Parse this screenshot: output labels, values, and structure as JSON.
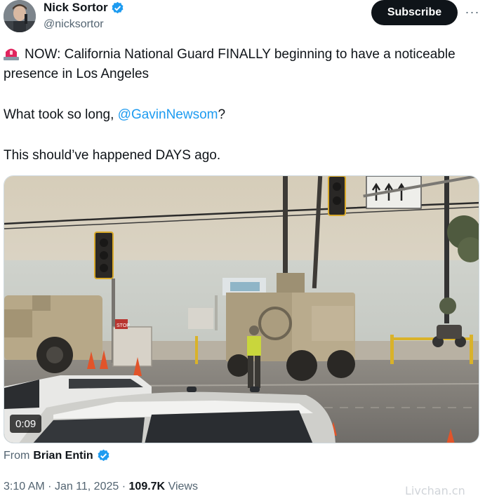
{
  "author": {
    "name": "Nick Sortor",
    "handle": "@nicksortor",
    "verified": true,
    "avatar_icon": "profile-photo"
  },
  "actions": {
    "subscribe_label": "Subscribe",
    "more_label": "···"
  },
  "tweet": {
    "line1_emoji": "rotating-light-icon",
    "line1": "NOW: California National Guard FINALLY beginning to have a noticeable presence in Los Angeles",
    "line2_prefix": "What took so long, ",
    "line2_mention": "@GavinNewsom",
    "line2_suffix": "?",
    "line3": "This should’ve happened DAYS ago."
  },
  "media": {
    "type": "video",
    "duration": "0:09",
    "sign_text": "STOP"
  },
  "attribution": {
    "prefix": "From",
    "name": "Brian Entin",
    "verified": true
  },
  "meta": {
    "time": "3:10 AM",
    "separator": "·",
    "date": "Jan 11, 2025",
    "views_count": "109.7K",
    "views_label": "Views"
  },
  "watermark": "Livchan.cn",
  "colors": {
    "accent": "#1d9bf0",
    "text_primary": "#0f1419",
    "text_secondary": "#536471",
    "button_bg": "#0f1419"
  }
}
